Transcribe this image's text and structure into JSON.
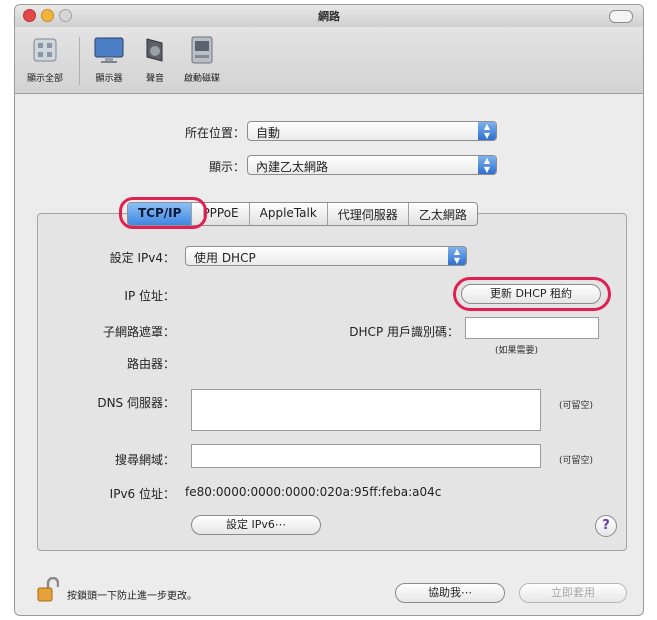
{
  "window": {
    "title": "網路"
  },
  "toolbar": {
    "items": [
      {
        "label": "顯示全部",
        "icon": "show-all-icon"
      },
      {
        "label": "顯示器",
        "icon": "display-icon"
      },
      {
        "label": "聲音",
        "icon": "sound-icon"
      },
      {
        "label": "啟動磁碟",
        "icon": "startup-disk-icon"
      }
    ]
  },
  "location": {
    "label": "所在位置：",
    "value": "自動"
  },
  "show": {
    "label": "顯示：",
    "value": "內建乙太網路"
  },
  "tabs": [
    {
      "label": "TCP/IP",
      "active": true
    },
    {
      "label": "PPPoE",
      "active": false
    },
    {
      "label": "AppleTalk",
      "active": false
    },
    {
      "label": "代理伺服器",
      "active": false
    },
    {
      "label": "乙太網路",
      "active": false
    }
  ],
  "ipv4": {
    "label": "設定 IPv4：",
    "value": "使用 DHCP"
  },
  "ip_address": {
    "label": "IP 位址：",
    "value": ""
  },
  "renew_button": "更新 DHCP 租約",
  "subnet": {
    "label": "子網路遮罩："
  },
  "dhcp_client": {
    "label": "DHCP 用戶識別碼：",
    "hint": "(如果需要)",
    "value": ""
  },
  "router": {
    "label": "路由器："
  },
  "dns": {
    "label": "DNS 伺服器：",
    "optional": "(可留空)"
  },
  "search_domains": {
    "label": "搜尋網域：",
    "optional": "(可留空)"
  },
  "ipv6": {
    "label": "IPv6 位址：",
    "value": "fe80:0000:0000:0000:020a:95ff:feba:a04c"
  },
  "ipv6_button": "設定 IPv6⋯",
  "help_label": "?",
  "lock_text": "按鎖頭一下防止進一步更改。",
  "assist_button": "協助我⋯",
  "apply_button": "立即套用",
  "colors": {
    "highlight": "#e02050",
    "active_tab": "#3f86e0"
  }
}
